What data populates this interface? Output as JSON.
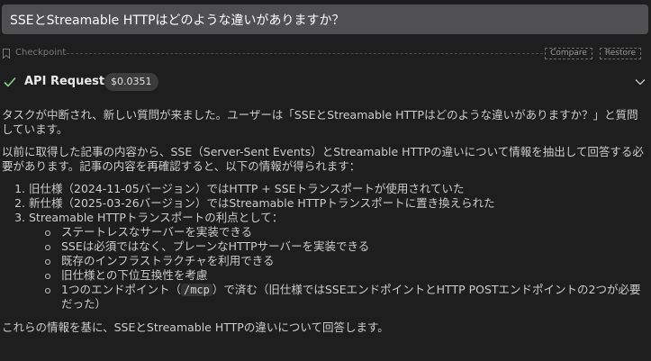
{
  "user_message": "SSEとStreamable HTTPはどのような違いがありますか？",
  "checkpoint": {
    "label": "Checkpoint",
    "compare_label": "Compare",
    "restore_label": "Restore"
  },
  "api_request": {
    "title": "API Request",
    "cost": "$0.0351",
    "status": "completed",
    "check_color": "#89d185"
  },
  "response": {
    "p1": "タスクが中断され、新しい質問が来ました。ユーザーは「SSEとStreamable HTTPはどのような違いがありますか？」と質問しています。",
    "p2": "以前に取得した記事の内容から、SSE（Server-Sent Events）とStreamable HTTPの違いについて情報を抽出して回答する必要があります。記事の内容を再確認すると、以下の情報が得られます：",
    "list": [
      "旧仕様（2024-11-05バージョン）ではHTTP + SSEトランスポートが使用されていた",
      "新仕様（2025-03-26バージョン）ではStreamable HTTPトランスポートに置き換えられた",
      "Streamable HTTPトランスポートの利点として："
    ],
    "sublist": [
      "ステートレスなサーバーを実装できる",
      "SSEは必須ではなく、プレーンなHTTPサーバーを実装できる",
      "既存のインフラストラクチャを利用できる",
      "旧仕様との下位互換性を考慮"
    ],
    "last_item": {
      "before": "1つのエンドポイント（",
      "code": "/mcp",
      "after": "）で済む（旧仕様ではSSEエンドポイントとHTTP POSTエンドポイントの2つが必要だった）"
    },
    "p3": "これらの情報を基に、SSEとStreamable HTTPの違いについて回答します。"
  }
}
